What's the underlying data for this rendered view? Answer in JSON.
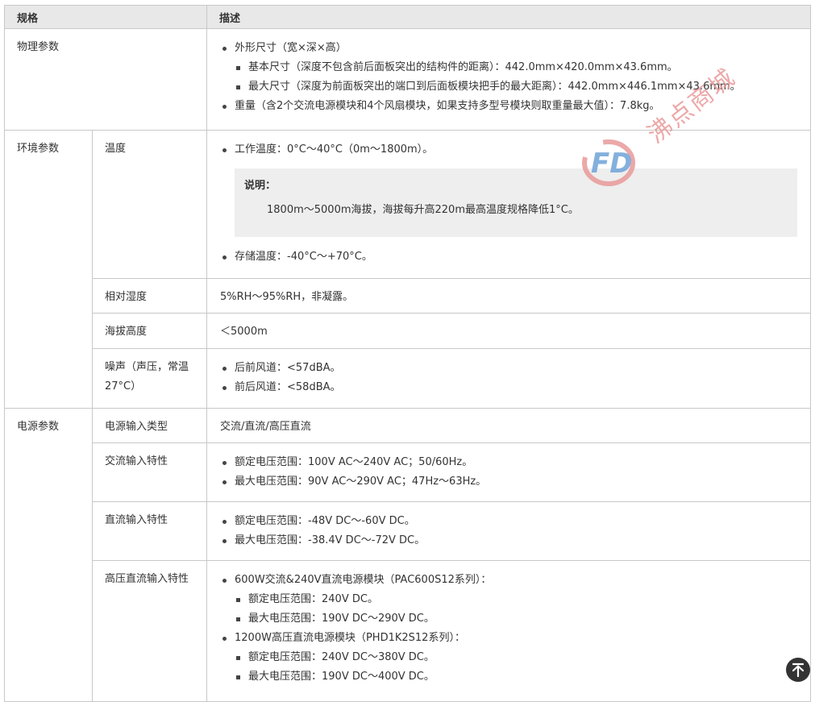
{
  "header": {
    "col_spec": "规格",
    "col_desc": "描述"
  },
  "physical": {
    "label": "物理参数",
    "dimensions": "外形尺寸（宽×深×高）",
    "basic_size": "基本尺寸（深度不包含前后面板突出的结构件的距离）：442.0mm×420.0mm×43.6mm。",
    "max_size": "最大尺寸（深度为前面板突出的端口到后面板模块把手的最大距离）：442.0mm×446.1mm×43.6mm。",
    "weight": "重量（含2个交流电源模块和4个风扇模块，如果支持多型号模块则取重量最大值）：7.8kg。"
  },
  "environment": {
    "label": "环境参数",
    "temperature": {
      "label": "温度",
      "operating": "工作温度：0°C～40°C（0m～1800m）。",
      "note_title": "说明：",
      "note_text": "1800m～5000m海拔，海拔每升高220m最高温度规格降低1°C。",
      "storage": "存储温度：-40°C～+70°C。"
    },
    "humidity": {
      "label": "相对湿度",
      "value": "5%RH～95%RH，非凝露。"
    },
    "altitude": {
      "label": "海拔高度",
      "value": "＜5000m"
    },
    "noise": {
      "label": "噪声（声压，常温27°C）",
      "rear_front": "后前风道：<57dBA。",
      "front_rear": "前后风道：<58dBA。"
    }
  },
  "power": {
    "label": "电源参数",
    "input_type": {
      "label": "电源输入类型",
      "value": "交流/直流/高压直流"
    },
    "ac": {
      "label": "交流输入特性",
      "rated": "额定电压范围：100V AC～240V AC；50/60Hz。",
      "max": "最大电压范围：90V AC～290V AC；47Hz～63Hz。"
    },
    "dc": {
      "label": "直流输入特性",
      "rated": "额定电压范围：-48V DC～-60V DC。",
      "max": "最大电压范围：-38.4V DC～-72V DC。"
    },
    "hvdc": {
      "label": "高压直流输入特性",
      "module1": "600W交流&240V直流电源模块（PAC600S12系列）：",
      "module1_rated": "额定电压范围：240V DC。",
      "module1_max": "最大电压范围：190V DC～290V DC。",
      "module2": "1200W高压直流电源模块（PHD1K2S12系列）：",
      "module2_rated": "额定电压范围：240V DC～380V DC。",
      "module2_max": "最大电压范围：190V DC～400V DC。"
    }
  },
  "watermark": {
    "text": "沸点商城",
    "logo_text": "FD"
  },
  "icons": {
    "back_to_top": "arrow-up-to-top-icon"
  },
  "colors": {
    "header_bg": "#e8e8e8",
    "border": "#c8c8c8",
    "note_bg": "#eeeeee",
    "watermark_red": "#e99a9a",
    "watermark_blue": "#6fa3d8"
  }
}
